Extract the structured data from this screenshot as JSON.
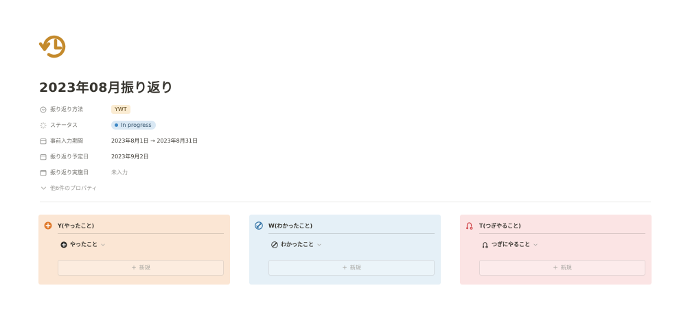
{
  "page": {
    "title": "2023年08月振り返り",
    "icon": "history-icon",
    "icon_color": "#c48a2c"
  },
  "properties": [
    {
      "name": "振り返り方法",
      "icon": "circle-dot-icon",
      "value": "YWT",
      "type": "tag"
    },
    {
      "name": "ステータス",
      "icon": "status-spinner-icon",
      "value": "In progress",
      "type": "status"
    },
    {
      "name": "事前入力期間",
      "icon": "calendar-icon",
      "value": "2023年8月1日 → 2023年8月31日",
      "type": "date"
    },
    {
      "name": "振り返り予定日",
      "icon": "calendar-icon",
      "value": "2023年9月2日",
      "type": "date"
    },
    {
      "name": "振り返り実施日",
      "icon": "calendar-icon",
      "value": "未入力",
      "type": "empty"
    }
  ],
  "more_properties": "他6件のプロパティ",
  "columns": [
    {
      "title": "Y(やったこと)",
      "item": "やったこと",
      "new_label": "新規",
      "bg": "#fbe6d4",
      "icon": "plus-circle-icon"
    },
    {
      "title": "W(わかったこと)",
      "item": "わかったこと",
      "new_label": "新規",
      "bg": "#e5f0f7",
      "icon": "rocket-icon"
    },
    {
      "title": "T(つぎやること)",
      "item": "つぎにやること",
      "new_label": "新規",
      "bg": "#fbe4e4",
      "icon": "route-icon"
    }
  ]
}
